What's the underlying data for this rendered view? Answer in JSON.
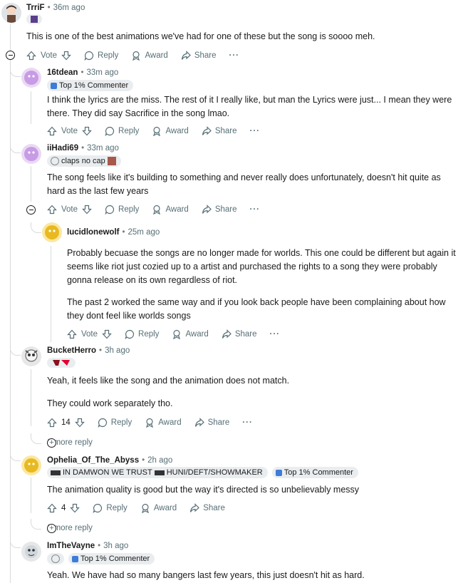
{
  "comments": [
    {
      "author": "TrriF",
      "time": "36m ago",
      "text": "This is one of the best animations we've had for one of these but the song is soooo meh.",
      "vote_label": "Vote"
    },
    {
      "author": "16tdean",
      "time": "33m ago",
      "flair": "Top 1% Commenter",
      "text": "I think the lyrics are the miss. The rest of it I really like, but man the Lyrics were just... I mean they were there. They did say Sacrifice in the song lmao.",
      "vote_label": "Vote"
    },
    {
      "author": "iiHadi69",
      "time": "33m ago",
      "flair": "claps no cap",
      "text": "The song feels like it's building to something and never really does unfortunately, doesn't hit quite as hard as the last few years",
      "vote_label": "Vote"
    },
    {
      "author": "lucidlonewolf",
      "time": "25m ago",
      "text_p1": "Probably becuase the songs are no longer made for worlds. This one could be different but again it seems like riot just cozied up to a artist and purchased the rights to a song they were probably gonna release on its own regardless of riot.",
      "text_p2": "The past 2 worked the same way and if you look back people have been complaining about how they dont feel like worlds songs",
      "vote_label": "Vote"
    },
    {
      "author": "BucketHerro",
      "time": "3h ago",
      "text_p1": "Yeah, it feels like the song and the animation does not match.",
      "text_p2": "They could work separately tho.",
      "votes": "14",
      "more_replies": "1 more reply"
    },
    {
      "author": "Ophelia_Of_The_Abyss",
      "time": "2h ago",
      "flair_text": "IN DAMWON WE TRUST",
      "flair_text2": "HUNI/DEFT/SHOWMAKER",
      "flair2": "Top 1% Commenter",
      "text": "The animation quality is good but the way it's directed is so unbelievably messy",
      "votes": "4",
      "more_replies": "1 more reply"
    },
    {
      "author": "ImTheVayne",
      "time": "3h ago",
      "flair2": "Top 1% Commenter",
      "text": "Yeah. We have had so many bangers last few years, this just doesn't hit as hard."
    }
  ],
  "actions": {
    "reply": "Reply",
    "award": "Award",
    "share": "Share",
    "more": "···"
  }
}
